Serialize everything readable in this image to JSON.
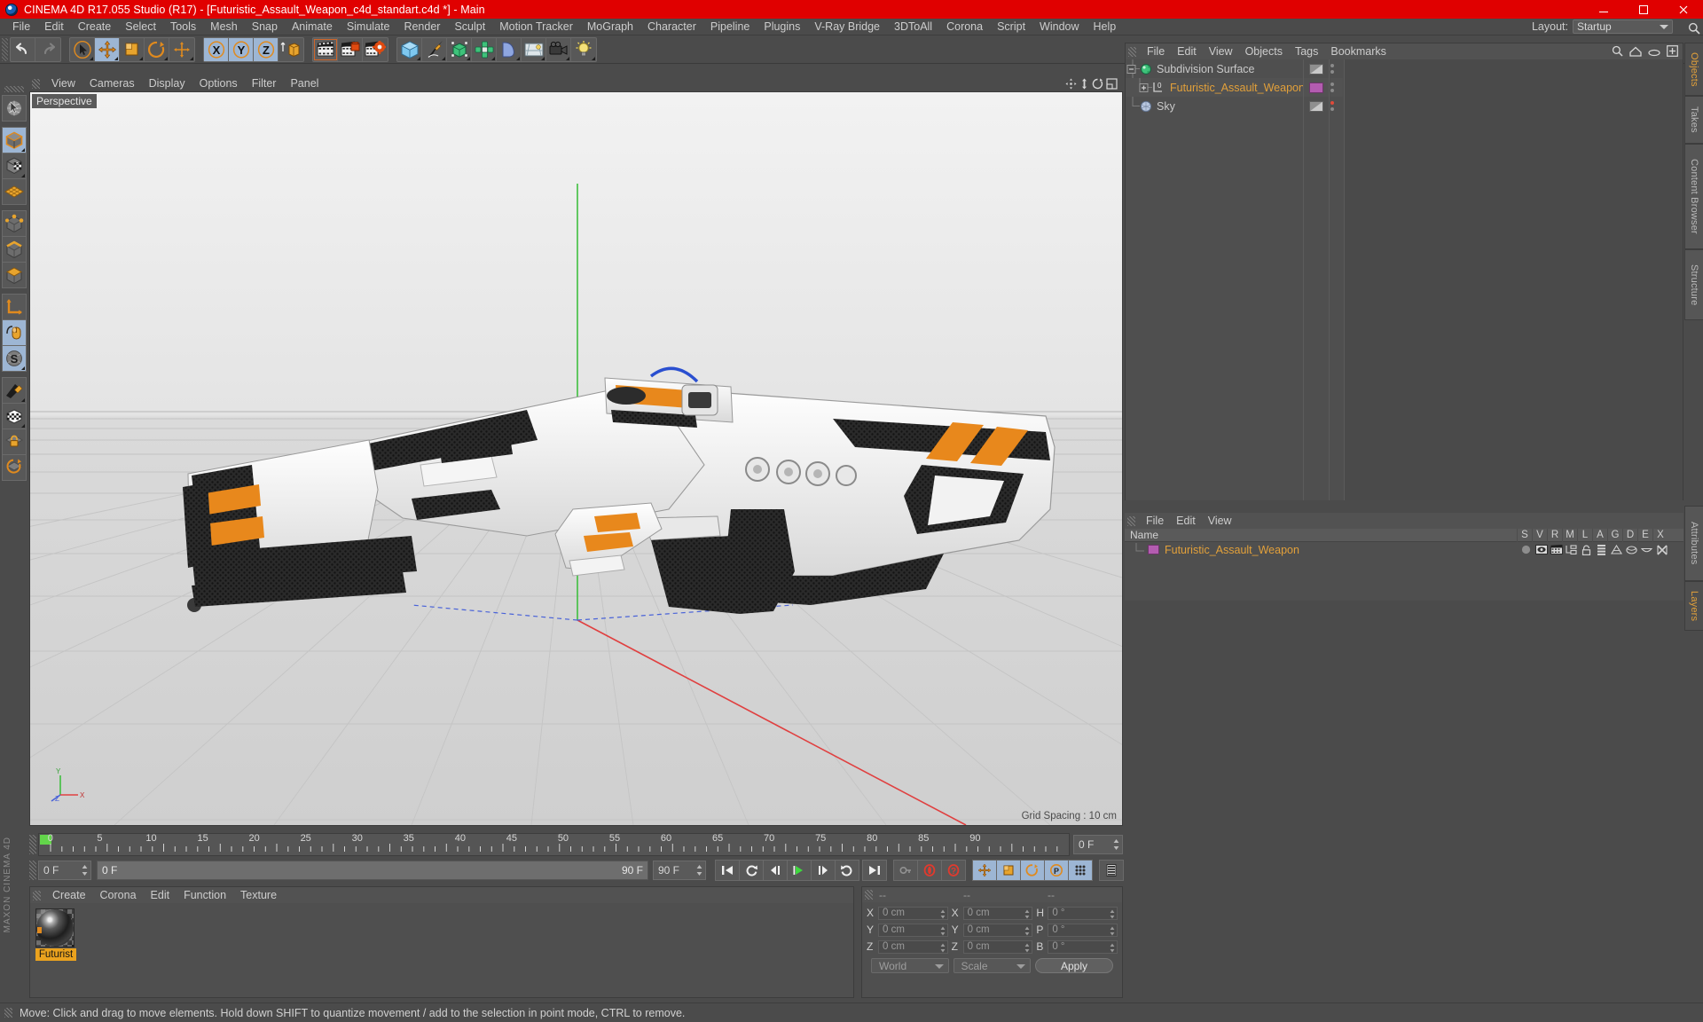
{
  "window": {
    "title": "CINEMA 4D R17.055 Studio (R17) - [Futuristic_Assault_Weapon_c4d_standart.c4d *] - Main",
    "minimize": "minimize-icon",
    "maximize": "maximize-icon",
    "close": "close-icon",
    "titlebar_color": "#e00000"
  },
  "menubar": {
    "items": [
      {
        "label": "File"
      },
      {
        "label": "Edit"
      },
      {
        "label": "Create"
      },
      {
        "label": "Select"
      },
      {
        "label": "Tools"
      },
      {
        "label": "Mesh"
      },
      {
        "label": "Snap"
      },
      {
        "label": "Animate"
      },
      {
        "label": "Simulate"
      },
      {
        "label": "Render"
      },
      {
        "label": "Sculpt"
      },
      {
        "label": "Motion Tracker"
      },
      {
        "label": "MoGraph"
      },
      {
        "label": "Character"
      },
      {
        "label": "Pipeline"
      },
      {
        "label": "Plugins"
      },
      {
        "label": "V-Ray Bridge"
      },
      {
        "label": "3DToAll"
      },
      {
        "label": "Corona"
      },
      {
        "label": "Script"
      },
      {
        "label": "Window"
      },
      {
        "label": "Help"
      }
    ],
    "layout_label": "Layout:",
    "layout_value": "Startup"
  },
  "toolbar": {
    "groups": [
      {
        "buttons": [
          {
            "name": "undo-button",
            "icon": "undo-arrow"
          },
          {
            "name": "redo-button",
            "icon": "redo-arrow"
          }
        ]
      },
      {
        "buttons": [
          {
            "name": "live-selection-tool",
            "icon": "cursor-circle",
            "state": "off"
          },
          {
            "name": "move-tool",
            "icon": "move-cross",
            "state": "on"
          },
          {
            "name": "scale-tool",
            "icon": "scale-box",
            "state": "off"
          },
          {
            "name": "rotate-tool",
            "icon": "rotate-circle",
            "state": "off"
          },
          {
            "name": "transform-tool",
            "icon": "plus-cross",
            "state": "off"
          }
        ]
      },
      {
        "buttons": [
          {
            "name": "lock-x-axis",
            "icon": "axis-x",
            "state": "on"
          },
          {
            "name": "lock-y-axis",
            "icon": "axis-y",
            "state": "on"
          },
          {
            "name": "lock-z-axis",
            "icon": "axis-z",
            "state": "on"
          },
          {
            "name": "world-object-coordinates",
            "icon": "world-axis",
            "state": "off"
          }
        ]
      },
      {
        "buttons": [
          {
            "name": "render-view-button",
            "icon": "clapper",
            "state": "sel"
          },
          {
            "name": "render-to-picture-viewer-button",
            "icon": "clapper-frame",
            "state": "off"
          },
          {
            "name": "render-settings-button",
            "icon": "clapper-gear",
            "state": "off"
          }
        ]
      },
      {
        "buttons": [
          {
            "name": "add-cube-button",
            "icon": "cube-blue"
          },
          {
            "name": "add-spline-button",
            "icon": "pen-spline"
          },
          {
            "name": "add-generator-button",
            "icon": "nurbs-green"
          },
          {
            "name": "add-array-button",
            "icon": "array-green"
          },
          {
            "name": "add-deformer-button",
            "icon": "bend-blue"
          },
          {
            "name": "add-environment-button",
            "icon": "floor-env"
          },
          {
            "name": "add-camera-button",
            "icon": "camera"
          },
          {
            "name": "add-light-button",
            "icon": "light-bulb"
          }
        ]
      }
    ]
  },
  "left_toolbar": {
    "buttons": [
      {
        "name": "tool-live-selection",
        "icon": "globe-selection",
        "state": "off"
      },
      {
        "name": "tool-model-mode",
        "icon": "cube-model",
        "state": "on"
      },
      {
        "name": "tool-texture-mode",
        "icon": "cube-texture",
        "state": "off"
      },
      {
        "name": "tool-polygon-grid",
        "icon": "grid-diamond",
        "state": "off"
      },
      {
        "name": "tool-point-mode",
        "icon": "cube-points",
        "state": "off"
      },
      {
        "name": "tool-edge-mode",
        "icon": "cube-edge",
        "state": "off"
      },
      {
        "name": "tool-polygon-mode",
        "icon": "cube-polygon",
        "state": "off"
      },
      {
        "name": "tool-axis-mode",
        "icon": "axis-l",
        "state": "off"
      },
      {
        "name": "tool-enable-snapping",
        "icon": "mouse-snap",
        "state": "on"
      },
      {
        "name": "tool-workplane",
        "icon": "s-disc",
        "state": "on"
      },
      {
        "name": "tool-knife",
        "icon": "knife",
        "state": "off"
      },
      {
        "name": "tool-viewport-solo",
        "icon": "checker-ball",
        "state": "off"
      },
      {
        "name": "tool-lock-workplane",
        "icon": "lock-plane",
        "state": "off"
      },
      {
        "name": "tool-workplane-rotate",
        "icon": "rotate-plane",
        "state": "off"
      }
    ],
    "branding": "MAXON CINEMA 4D"
  },
  "viewport": {
    "menu": [
      {
        "label": "View"
      },
      {
        "label": "Cameras"
      },
      {
        "label": "Display"
      },
      {
        "label": "Options"
      },
      {
        "label": "Filter"
      },
      {
        "label": "Panel"
      }
    ],
    "label": "Perspective",
    "grid_spacing": "Grid Spacing : 10 cm",
    "axis_labels": [
      "Y",
      "X",
      "Z"
    ],
    "nav_icons": [
      "pan-icon",
      "dolly-icon",
      "orbit-icon",
      "maximize-view-icon"
    ]
  },
  "object_manager": {
    "menu": [
      {
        "label": "File"
      },
      {
        "label": "Edit"
      },
      {
        "label": "View"
      },
      {
        "label": "Objects"
      },
      {
        "label": "Tags"
      },
      {
        "label": "Bookmarks"
      }
    ],
    "header_icons": [
      "search-icon",
      "home-icon",
      "ellipse-icon",
      "plus-box-icon"
    ],
    "rows": [
      {
        "name": "Subdivision Surface",
        "icon": "subdivision-surface-icon",
        "indent": 0,
        "expander": "minus",
        "tag": "checker",
        "dot": "check",
        "selected": false
      },
      {
        "name": "Futuristic_Assault_Weapon",
        "icon": "null-object-icon",
        "indent": 1,
        "expander": "plus",
        "tag": "magenta",
        "dot": "none",
        "selected": true
      },
      {
        "name": "Sky",
        "icon": "sky-icon",
        "indent": 0,
        "expander": "none",
        "tag": "checker",
        "dot": "red",
        "selected": false
      }
    ]
  },
  "material_tags_manager": {
    "menu": [
      {
        "label": "File"
      },
      {
        "label": "Edit"
      },
      {
        "label": "View"
      }
    ],
    "name_header": "Name",
    "columns": [
      "S",
      "V",
      "R",
      "M",
      "L",
      "A",
      "G",
      "D",
      "E",
      "X"
    ],
    "rows": [
      {
        "name": "Futuristic_Assault_Weapon",
        "swatch": "#b35cb0"
      }
    ]
  },
  "right_tabs": {
    "top": [
      {
        "label": "Objects",
        "active": true
      },
      {
        "label": "Takes",
        "active": false
      },
      {
        "label": "Content Browser",
        "active": false
      },
      {
        "label": "Structure",
        "active": false
      }
    ],
    "bottom": [
      {
        "label": "Attributes",
        "active": false
      },
      {
        "label": "Layers",
        "active": true
      }
    ],
    "search_icon": "search-icon"
  },
  "timeline": {
    "ticks": [
      0,
      5,
      10,
      15,
      20,
      25,
      30,
      35,
      40,
      45,
      50,
      55,
      60,
      65,
      70,
      75,
      80,
      85,
      90
    ],
    "current_frame_field": "0 F",
    "playhead_frame": 0,
    "range_start": 0,
    "range_end": 90
  },
  "transport": {
    "start_field": "0 F",
    "slider_left": "0 F",
    "slider_right": "90 F",
    "end_field": "90 F",
    "buttons": [
      {
        "name": "go-to-start-button",
        "icon": "skip-back"
      },
      {
        "name": "go-to-previous-key-button",
        "icon": "prev-key"
      },
      {
        "name": "go-to-previous-frame-button",
        "icon": "step-back"
      },
      {
        "name": "play-button",
        "icon": "play"
      },
      {
        "name": "go-to-next-frame-button",
        "icon": "step-forward"
      },
      {
        "name": "go-to-next-key-button",
        "icon": "next-key"
      },
      {
        "name": "go-to-end-button",
        "icon": "skip-forward"
      }
    ],
    "record_buttons": [
      {
        "name": "autokeying-button",
        "icon": "key-circle",
        "state": "off"
      },
      {
        "name": "record-active-objects-button",
        "icon": "record-red",
        "state": "off"
      },
      {
        "name": "keyframe-selection-button",
        "icon": "question-red",
        "state": "off"
      }
    ],
    "param_buttons": [
      {
        "name": "record-position-button",
        "icon": "move-cross",
        "state": "on"
      },
      {
        "name": "record-scale-button",
        "icon": "scale-box",
        "state": "on"
      },
      {
        "name": "record-rotation-button",
        "icon": "rotate-circle",
        "state": "on"
      },
      {
        "name": "record-pla-button",
        "icon": "p-circle",
        "state": "on"
      },
      {
        "name": "point-level-animation-button",
        "icon": "dots-grid",
        "state": "on"
      }
    ],
    "level_of_detail_button": {
      "name": "timeline-toggle-button",
      "icon": "film-strip"
    }
  },
  "material_manager": {
    "menu": [
      {
        "label": "Create"
      },
      {
        "label": "Corona"
      },
      {
        "label": "Edit"
      },
      {
        "label": "Function"
      },
      {
        "label": "Texture"
      }
    ],
    "materials": [
      {
        "name": "Futurist",
        "preview": "metal-sphere-orange"
      }
    ]
  },
  "coordinates": {
    "header_dashes": [
      "--",
      "--",
      "--"
    ],
    "rows": [
      {
        "pos_label": "X",
        "pos_value": "0 cm",
        "size_label": "X",
        "size_value": "0 cm",
        "rot_label": "H",
        "rot_value": "0 °"
      },
      {
        "pos_label": "Y",
        "pos_value": "0 cm",
        "size_label": "Y",
        "size_value": "0 cm",
        "rot_label": "P",
        "rot_value": "0 °"
      },
      {
        "pos_label": "Z",
        "pos_value": "0 cm",
        "size_label": "Z",
        "size_value": "0 cm",
        "rot_label": "B",
        "rot_value": "0 °"
      }
    ],
    "world_select": "World",
    "scale_select": "Scale",
    "apply_button": "Apply"
  },
  "status": {
    "message": "Move: Click and drag to move elements. Hold down SHIFT to quantize movement / add to the selection in point mode, CTRL to remove."
  },
  "colors": {
    "accent_orange": "#e2a03a",
    "titlebar_red": "#e00000",
    "panel_bg": "#4b4b4b",
    "selection_blue": "#9db6d4",
    "magenta_tag": "#b35cb0"
  }
}
